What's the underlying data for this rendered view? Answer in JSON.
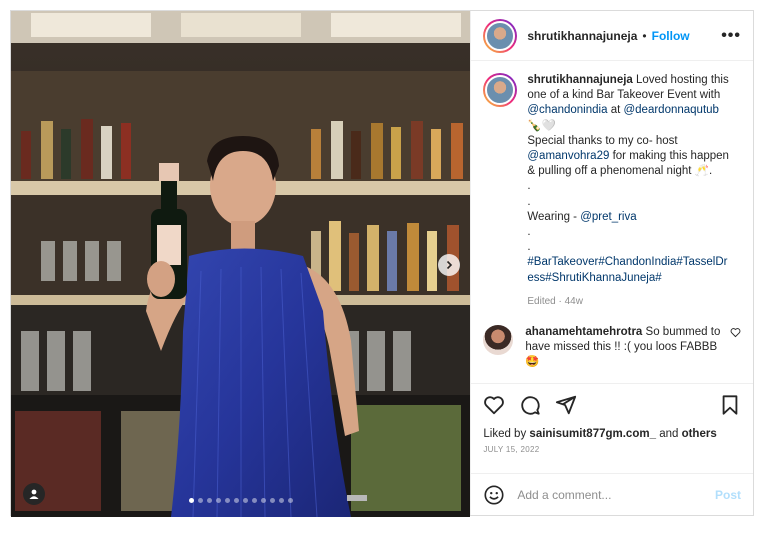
{
  "post": {
    "author": "shrutikhannajuneja",
    "separator": "•",
    "follow_label": "Follow",
    "more_label": "•••",
    "caption": {
      "author": "shrutikhannajuneja",
      "line1": "Loved hosting this one of a kind Bar Takeover Event with",
      "mention1": "@chandonindia",
      "line1b": "at",
      "mention2": "@deardonnaqutub",
      "emoji1": "🍾🤍",
      "line2": "Special thanks to my co- host",
      "mention3": "@amanvohra29",
      "line3": "for making this happen & pulling off a phenomenal night 🥂.",
      "dot1": ".",
      "dot2": ".",
      "wearing_label": "Wearing -",
      "mention4": "@pret_riva",
      "dot3": ".",
      "dot4": ".",
      "hashtags": "#BarTakeover#ChandonIndia#TasselDress#ShrutiKhannaJuneja#",
      "edited": "Edited · 44w"
    },
    "comments": [
      {
        "author": "ahanamehtamehrotra",
        "text": "So bummed to have missed this !! :( you loos FABBB 🤩"
      }
    ],
    "likes": {
      "prefix": "Liked by",
      "user": "sainisumit877gm.com_",
      "middle": "and",
      "others": "others"
    },
    "date": "JULY 15, 2022",
    "add_comment_placeholder": "Add a comment...",
    "post_label": "Post",
    "carousel": {
      "count": 12,
      "active_index": 0
    }
  },
  "icons": {
    "like": "heart-icon",
    "comment": "comment-icon",
    "share": "share-icon",
    "save": "bookmark-icon",
    "emoji": "emoji-icon",
    "more": "more-icon",
    "user_tag": "user-tag-icon",
    "next": "chevron-right-icon"
  },
  "colors": {
    "accent": "#0095f6",
    "link": "#00376b",
    "muted": "#8e8e8e",
    "post_disabled": "#b2dffc",
    "dress": "#2a3b9a"
  }
}
